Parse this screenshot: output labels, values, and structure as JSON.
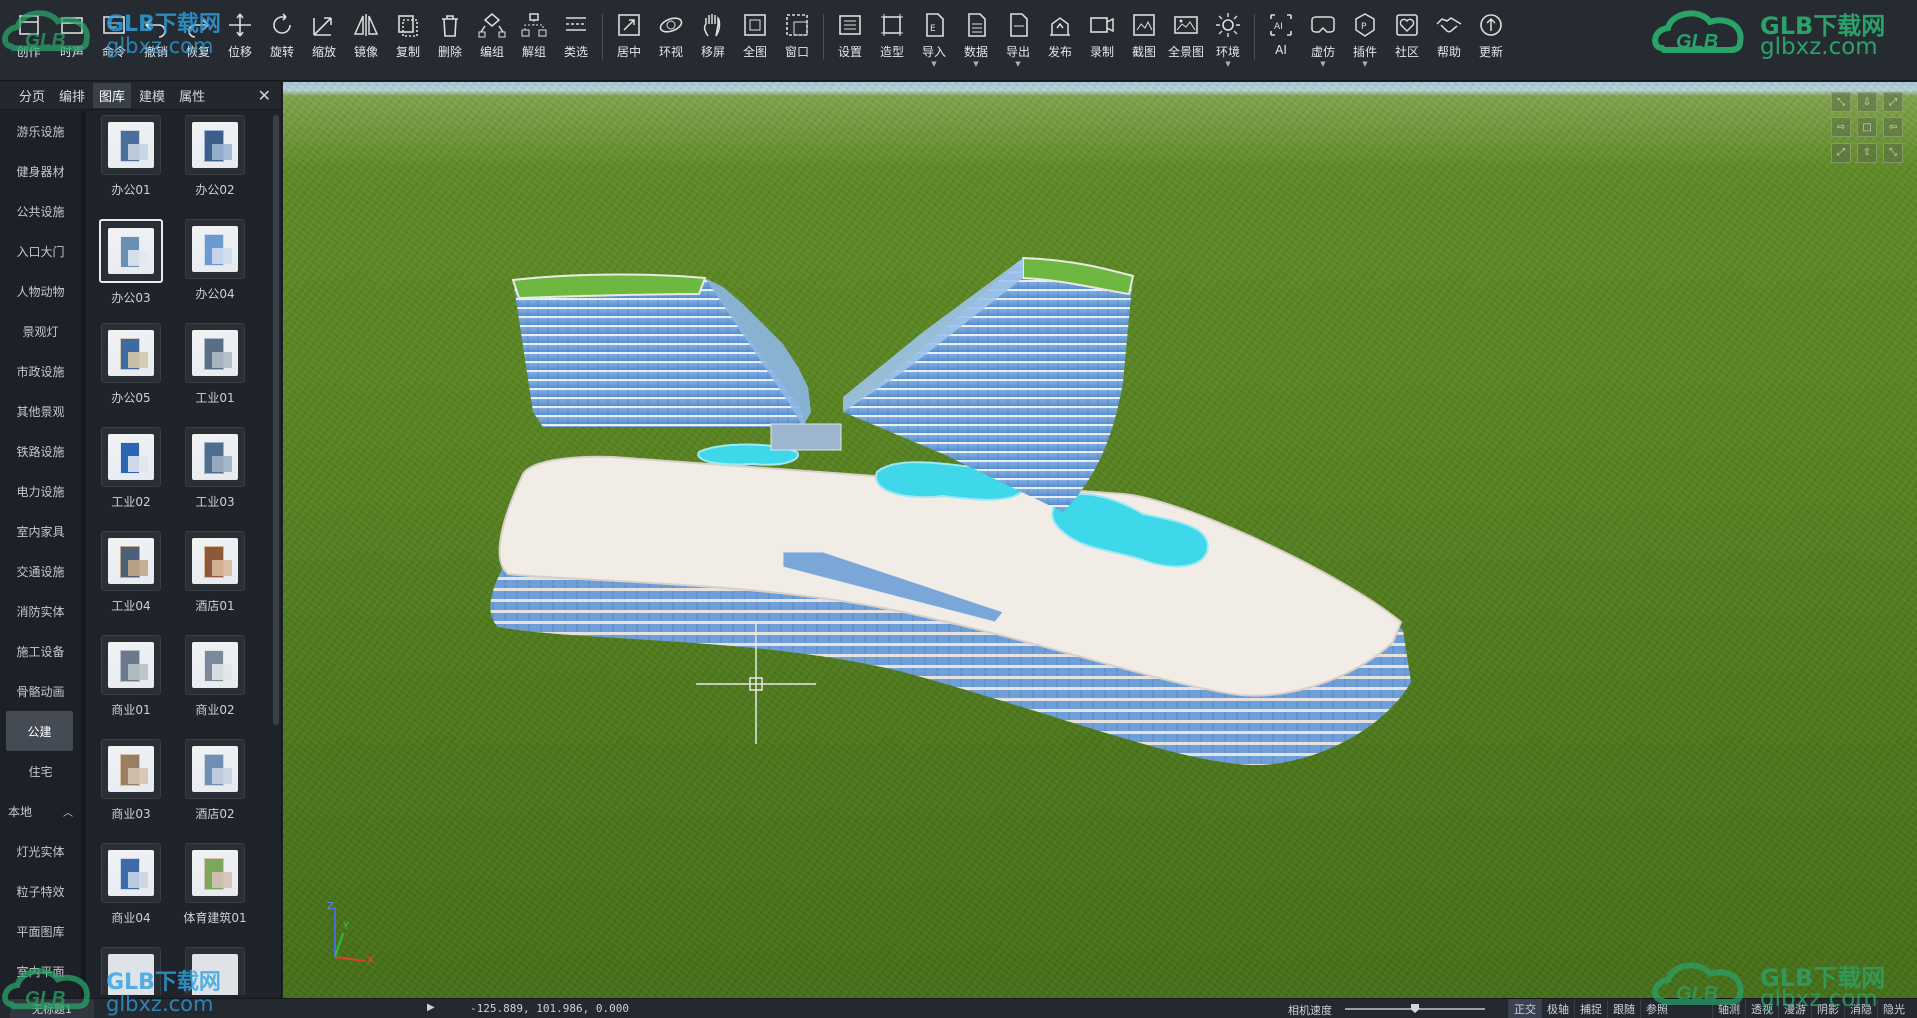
{
  "toolbar": {
    "buttons": [
      {
        "label": "创作",
        "icon": "create-icon"
      },
      {
        "label": "时声",
        "icon": "timeline-icon"
      },
      {
        "label": "命令",
        "icon": "command-icon"
      },
      {
        "label": "撤销",
        "icon": "undo-icon"
      },
      {
        "label": "恢复",
        "icon": "redo-icon"
      },
      {
        "label": "位移",
        "icon": "move-icon"
      },
      {
        "label": "旋转",
        "icon": "rotate-icon"
      },
      {
        "label": "缩放",
        "icon": "scale-icon"
      },
      {
        "label": "镜像",
        "icon": "mirror-icon"
      },
      {
        "label": "复制",
        "icon": "copy-icon"
      },
      {
        "label": "删除",
        "icon": "delete-icon"
      },
      {
        "label": "编组",
        "icon": "group-icon"
      },
      {
        "label": "解组",
        "icon": "ungroup-icon"
      },
      {
        "label": "类选",
        "icon": "select-type-icon"
      },
      {
        "label": "居中",
        "icon": "center-icon"
      },
      {
        "label": "环视",
        "icon": "orbit-icon"
      },
      {
        "label": "移屏",
        "icon": "pan-hand-icon"
      },
      {
        "label": "全图",
        "icon": "fit-all-icon"
      },
      {
        "label": "窗口",
        "icon": "window-zoom-icon"
      },
      {
        "label": "设置",
        "icon": "settings-icon"
      },
      {
        "label": "造型",
        "icon": "modeling-icon"
      },
      {
        "label": "导入",
        "icon": "import-icon",
        "dropdown": true
      },
      {
        "label": "数据",
        "icon": "data-icon",
        "dropdown": true
      },
      {
        "label": "导出",
        "icon": "export-icon",
        "dropdown": true
      },
      {
        "label": "发布",
        "icon": "publish-icon"
      },
      {
        "label": "录制",
        "icon": "record-icon"
      },
      {
        "label": "截图",
        "icon": "screenshot-icon"
      },
      {
        "label": "全景图",
        "icon": "panorama-icon"
      },
      {
        "label": "环境",
        "icon": "environment-sun-icon",
        "dropdown": true
      },
      {
        "label": "AI",
        "icon": "ai-icon"
      },
      {
        "label": "虚仿",
        "icon": "vr-icon",
        "dropdown": true
      },
      {
        "label": "插件",
        "icon": "plugin-icon",
        "dropdown": true
      },
      {
        "label": "社区",
        "icon": "community-icon"
      },
      {
        "label": "帮助",
        "icon": "help-handshake-icon"
      },
      {
        "label": "更新",
        "icon": "update-icon"
      }
    ]
  },
  "watermark": {
    "brand": "GLB下载网",
    "url": "glbxz.com",
    "logo_text": "GLB"
  },
  "panel": {
    "tabs": [
      "分页",
      "编排",
      "图库",
      "建模",
      "属性"
    ],
    "active_tab": "图库",
    "close_label": "✕",
    "categories": [
      "游乐设施",
      "健身器材",
      "公共设施",
      "入口大门",
      "人物动物",
      "景观灯",
      "市政设施",
      "其他景观",
      "铁路设施",
      "电力设施",
      "室内家具",
      "交通设施",
      "消防实体",
      "施工设备",
      "骨骼动画",
      "公建",
      "住宅",
      "本地",
      "灯光实体",
      "粒子特效",
      "平面图库",
      "室内平面"
    ],
    "active_category": "公建",
    "items": [
      "办公01",
      "办公02",
      "办公03",
      "办公04",
      "办公05",
      "工业01",
      "工业02",
      "工业03",
      "工业04",
      "酒店01",
      "商业01",
      "商业02",
      "商业03",
      "酒店02",
      "商业04",
      "体育建筑01"
    ],
    "selected_item": "办公03"
  },
  "viewport": {
    "nav_cube": [
      "⤡",
      "⇩",
      "⤢",
      "⇨",
      "□",
      "⇦",
      "⤢",
      "⇧",
      "⤡"
    ],
    "axes": {
      "x": "X",
      "y": "Y",
      "z": "Z"
    }
  },
  "status": {
    "doc_tab": "无标题1",
    "play": "▶",
    "coords": "-125.889, 101.986, 0.000",
    "camera_speed_label": "相机速度",
    "camera_speed": 0.5,
    "toggles": [
      {
        "label": "正交",
        "on": true
      },
      {
        "label": "极轴",
        "on": false
      },
      {
        "label": "捕捉",
        "on": false
      },
      {
        "label": "跟随",
        "on": false
      },
      {
        "label": "参照",
        "on": false
      }
    ],
    "toggles2": [
      "轴测",
      "透视",
      "漫游",
      "阴影",
      "消隐",
      "隐光"
    ]
  },
  "colors": {
    "accent_green_logo": "#2aa36a",
    "accent_blue_logo": "#2ea3e0",
    "pool": "#3fd7ea",
    "building_glass": "#6fa3d9"
  }
}
